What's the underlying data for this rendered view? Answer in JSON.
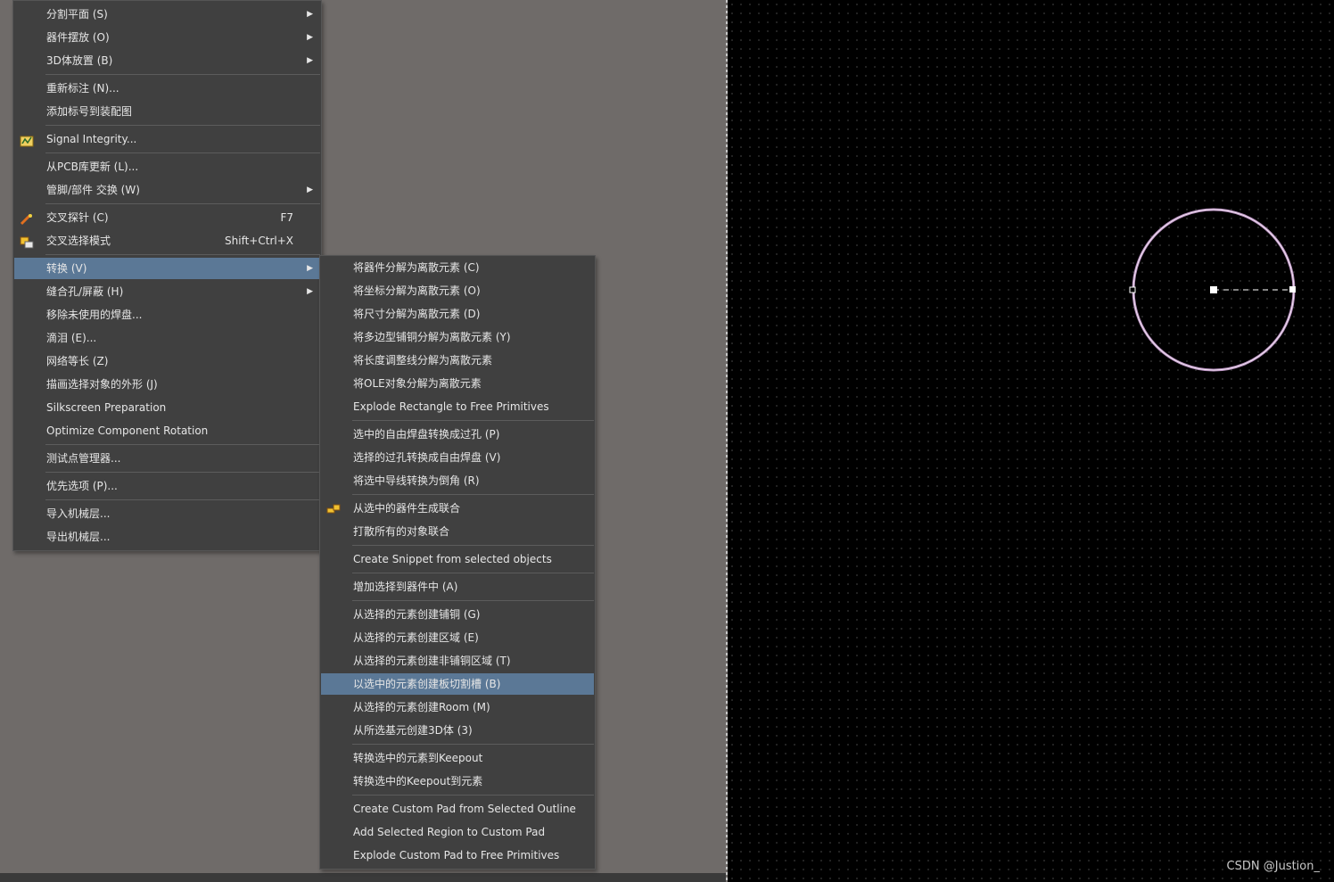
{
  "main_menu": {
    "items": [
      {
        "label": "分割平面 (S)",
        "arrow": "▶"
      },
      {
        "label": "器件摆放 (O)",
        "arrow": "▶"
      },
      {
        "label": "3D体放置 (B)",
        "arrow": "▶"
      },
      {
        "label": "重新标注 (N)..."
      },
      {
        "label": "添加标号到装配图"
      },
      {
        "label": "Signal Integrity...",
        "icon": "signal-integrity-icon"
      },
      {
        "label": "从PCB库更新 (L)..."
      },
      {
        "label": "管脚/部件 交换 (W)",
        "arrow": "▶"
      },
      {
        "label": "交叉探针 (C)",
        "shortcut": "F7",
        "icon": "cross-probe-icon"
      },
      {
        "label": "交叉选择模式",
        "shortcut": "Shift+Ctrl+X",
        "icon": "cross-select-icon"
      },
      {
        "label": "转换 (V)",
        "arrow": "▶"
      },
      {
        "label": "缝合孔/屏蔽 (H)",
        "arrow": "▶"
      },
      {
        "label": "移除未使用的焊盘..."
      },
      {
        "label": "滴泪 (E)..."
      },
      {
        "label": "网络等长 (Z)"
      },
      {
        "label": "描画选择对象的外形 (J)"
      },
      {
        "label": "Silkscreen Preparation"
      },
      {
        "label": "Optimize Component Rotation"
      },
      {
        "label": "测试点管理器..."
      },
      {
        "label": "优先选项 (P)..."
      },
      {
        "label": "导入机械层..."
      },
      {
        "label": "导出机械层..."
      }
    ]
  },
  "sub_menu": {
    "items": [
      {
        "label": "将器件分解为离散元素 (C)"
      },
      {
        "label": "将坐标分解为离散元素 (O)"
      },
      {
        "label": "将尺寸分解为离散元素 (D)"
      },
      {
        "label": "将多边型铺铜分解为离散元素 (Y)"
      },
      {
        "label": "将长度调整线分解为离散元素"
      },
      {
        "label": "将OLE对象分解为离散元素"
      },
      {
        "label": "Explode Rectangle to Free Primitives"
      },
      {
        "label": "选中的自由焊盘转换成过孔 (P)"
      },
      {
        "label": "选择的过孔转换成自由焊盘 (V)"
      },
      {
        "label": "将选中导线转换为倒角 (R)"
      },
      {
        "label": "从选中的器件生成联合",
        "icon": "union-icon"
      },
      {
        "label": "打散所有的对象联合"
      },
      {
        "label": "Create Snippet from selected objects"
      },
      {
        "label": "增加选择到器件中 (A)"
      },
      {
        "label": "从选择的元素创建铺铜 (G)"
      },
      {
        "label": "从选择的元素创建区域 (E)"
      },
      {
        "label": "从选择的元素创建非铺铜区域 (T)"
      },
      {
        "label": "以选中的元素创建板切割槽 (B)"
      },
      {
        "label": "从选择的元素创建Room (M)"
      },
      {
        "label": "从所选基元创建3D体 (3)"
      },
      {
        "label": "转换选中的元素到Keepout"
      },
      {
        "label": "转换选中的Keepout到元素"
      },
      {
        "label": "Create Custom Pad from Selected Outline"
      },
      {
        "label": "Add Selected Region to Custom Pad"
      },
      {
        "label": "Explode Custom Pad to Free Primitives"
      }
    ]
  },
  "watermark": "CSDN @Justion_",
  "colors": {
    "menu_bg": "#404040",
    "highlight": "#5b7896",
    "canvas": "#000000",
    "circle": "#e8c8e8",
    "workspace": "#6f6b69"
  }
}
